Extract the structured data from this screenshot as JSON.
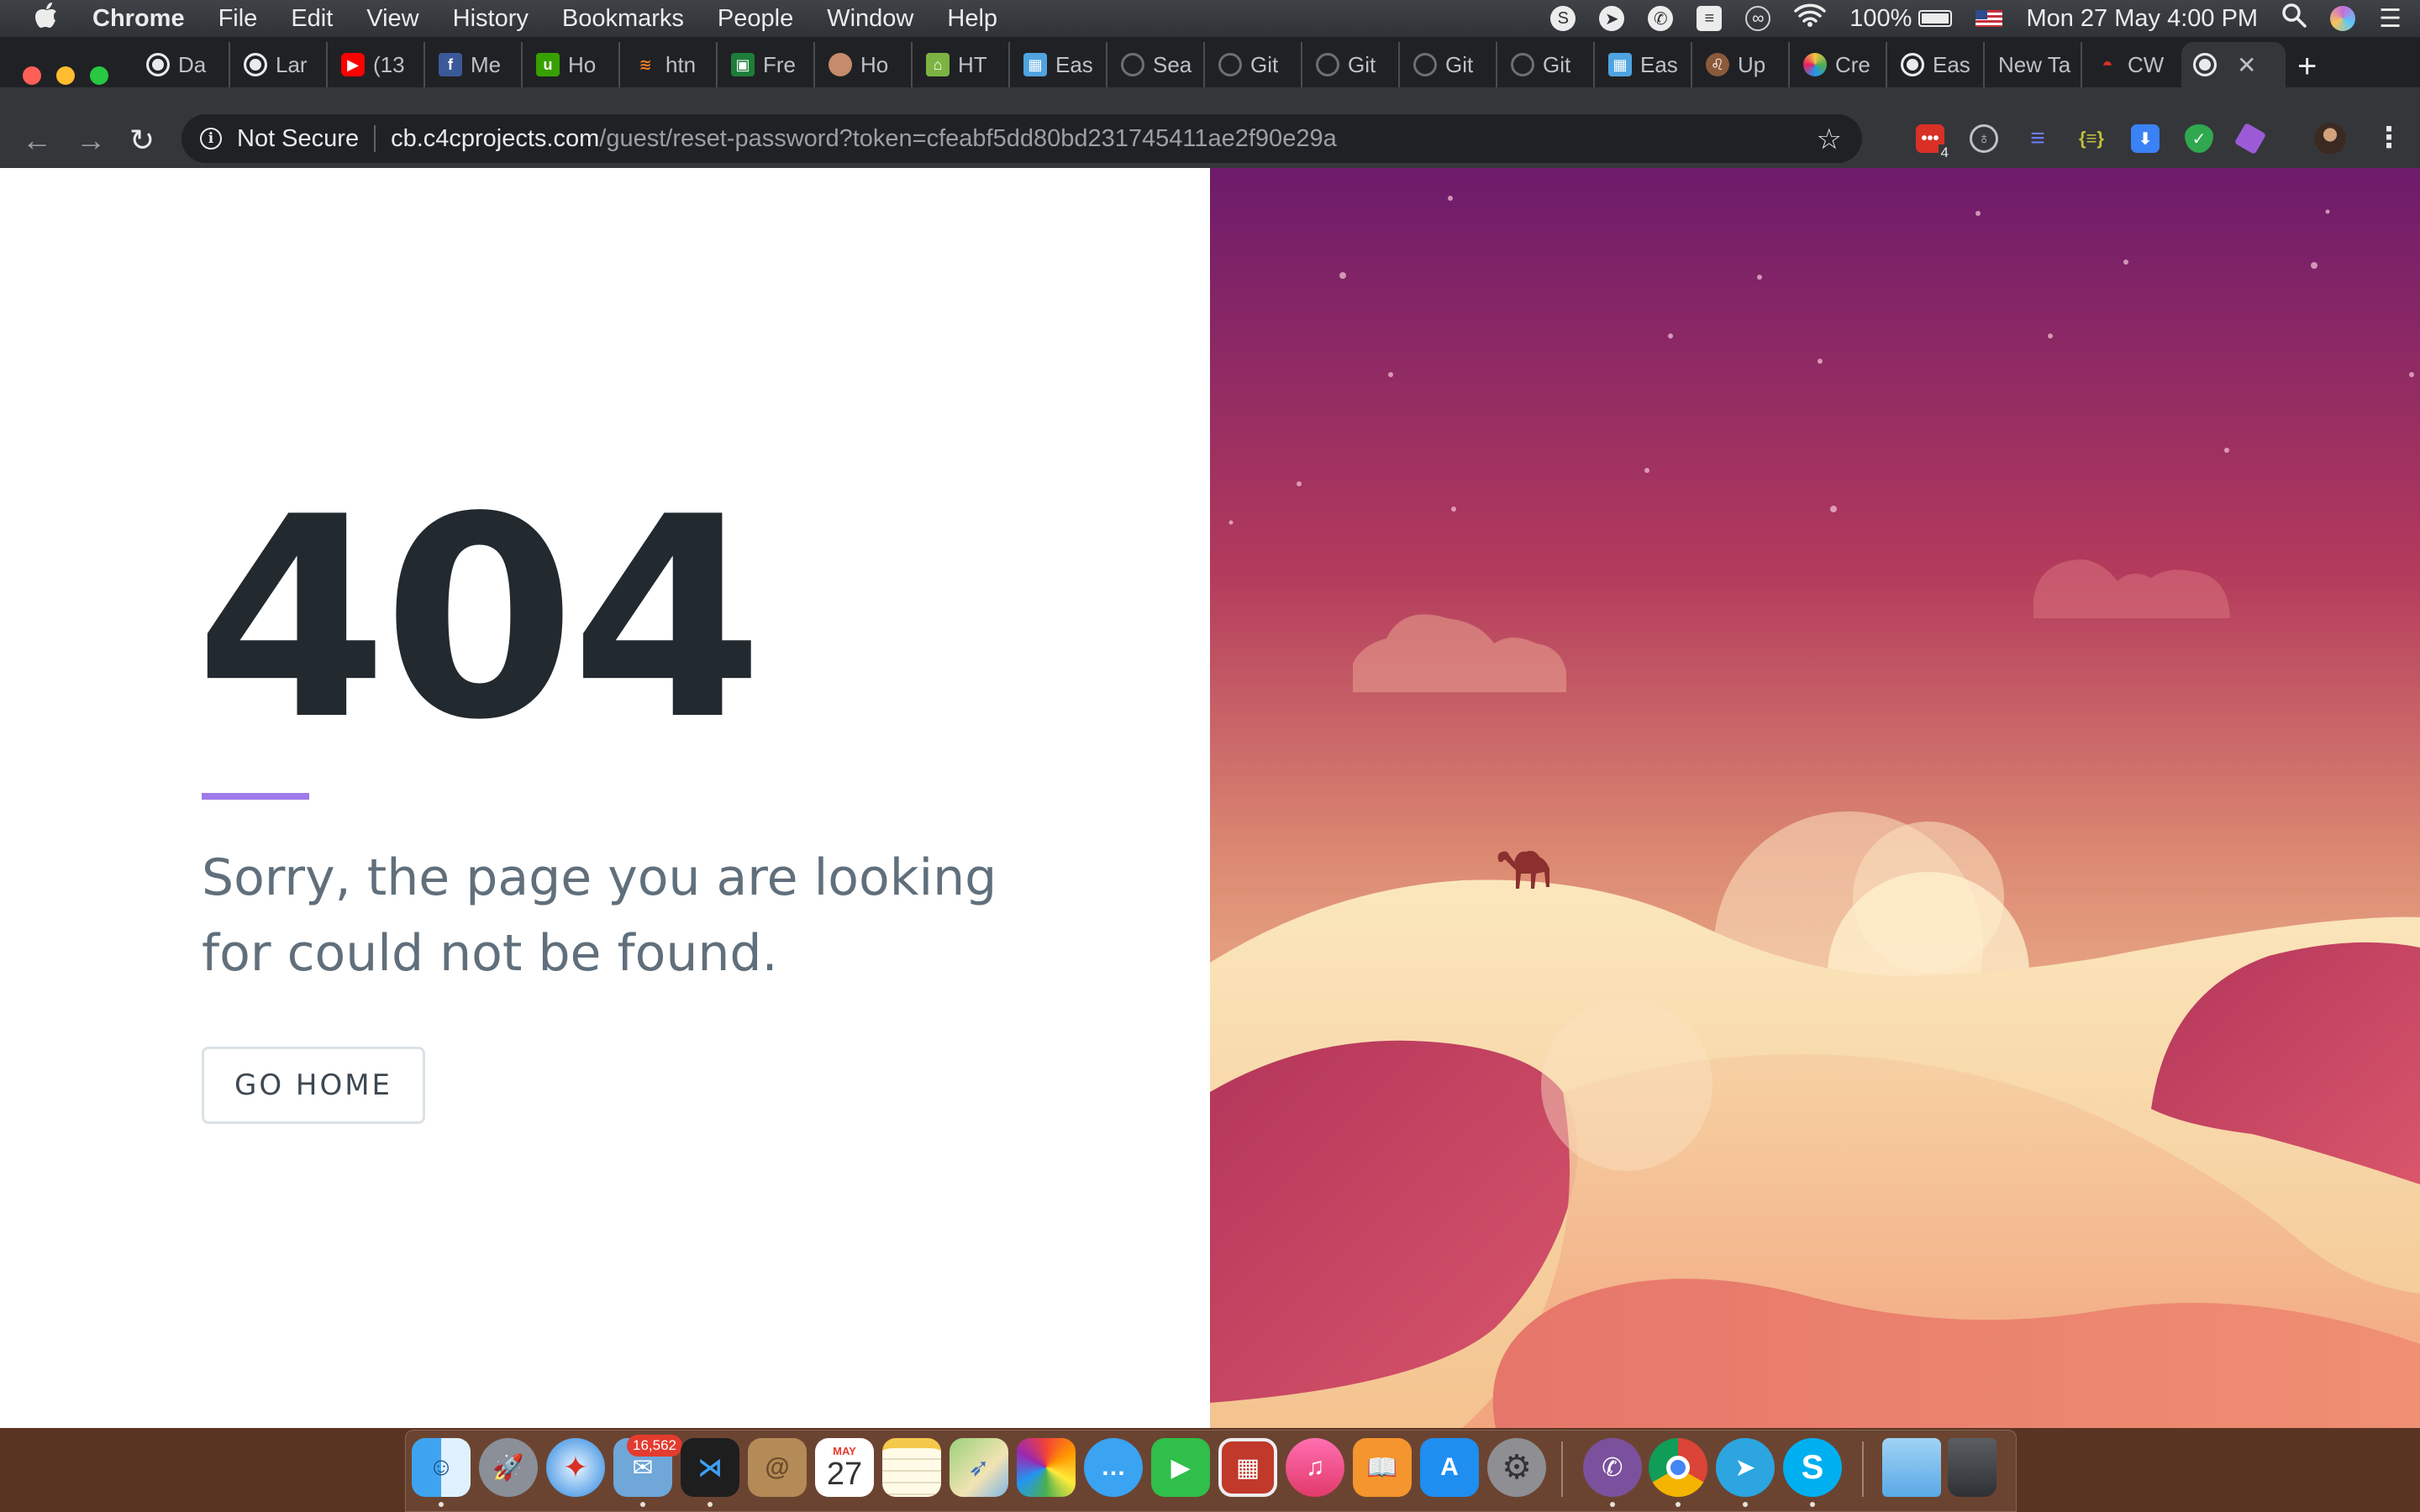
{
  "menubar": {
    "apple_icon": "",
    "app_name": "Chrome",
    "items": [
      "File",
      "Edit",
      "View",
      "History",
      "Bookmarks",
      "People",
      "Window",
      "Help"
    ],
    "battery_percent": "100%",
    "datetime": "Mon 27 May  4:00 PM"
  },
  "tabs": [
    {
      "title": "Da",
      "icon": "globe-icon"
    },
    {
      "title": "Lar",
      "icon": "globe-icon"
    },
    {
      "title": "(13",
      "icon": "youtube-icon"
    },
    {
      "title": "Me",
      "icon": "facebook-icon"
    },
    {
      "title": "Ho",
      "icon": "upwork-icon"
    },
    {
      "title": "htn",
      "icon": "stackoverflow-icon"
    },
    {
      "title": "Fre",
      "icon": "image-icon"
    },
    {
      "title": "Ho",
      "icon": "avatar-icon"
    },
    {
      "title": "HT",
      "icon": "html-icon"
    },
    {
      "title": "Eas",
      "icon": "cube-icon"
    },
    {
      "title": "Sea",
      "icon": "github-icon"
    },
    {
      "title": "Git",
      "icon": "github-icon"
    },
    {
      "title": "Git",
      "icon": "github-icon"
    },
    {
      "title": "Git",
      "icon": "github-icon"
    },
    {
      "title": "Git",
      "icon": "github-icon"
    },
    {
      "title": "Eas",
      "icon": "cube-icon"
    },
    {
      "title": "Up",
      "icon": "lion-icon"
    },
    {
      "title": "Cre",
      "icon": "palette-icon"
    },
    {
      "title": "Eas",
      "icon": "globe-icon"
    },
    {
      "title": "New Ta",
      "icon": ""
    },
    {
      "title": "CW",
      "icon": "cw-icon"
    }
  ],
  "active_tab": {
    "title": "",
    "icon": "globe-icon",
    "close_label": "✕"
  },
  "new_tab_label": "+",
  "toolbar": {
    "back": "←",
    "forward": "→",
    "reload": "↻",
    "security_icon": "i",
    "security_label": "Not Secure",
    "url_host": "cb.c4cprojects.com",
    "url_path": "/guest/reset-password?token=cfeabf5dd80bd231745411ae2f90e29a",
    "star": "☆",
    "extension_badge": "4",
    "menu": "⋮"
  },
  "error_page": {
    "code": "404",
    "message": "Sorry, the page you are looking for could not be found.",
    "button_label": "GO HOME",
    "accent_color": "#9f7aea"
  },
  "dock": {
    "mail_badge": "16,562",
    "calendar_month": "MAY",
    "calendar_day": "27"
  }
}
